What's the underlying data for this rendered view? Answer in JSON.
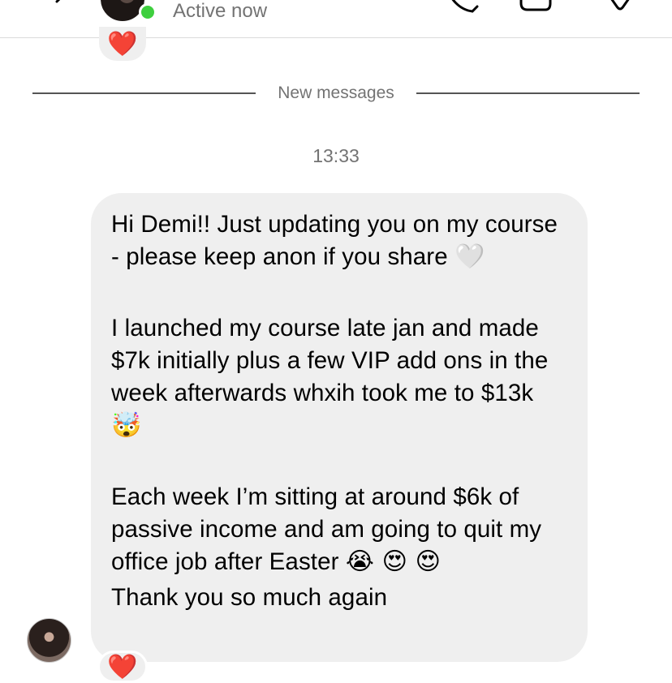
{
  "header": {
    "status": "Active now",
    "icons": [
      "back-icon",
      "avatar",
      "phone-icon",
      "video-icon",
      "tag-icon"
    ],
    "online_color": "#3ecf3e"
  },
  "reactions": {
    "top": "❤️",
    "bottom": "❤️"
  },
  "divider": {
    "label": "New messages"
  },
  "timestamp": "13:33",
  "message": {
    "p1": "Hi Demi!! Just updating you on my course - please keep anon if you share",
    "p1_emoji": "🤍",
    "p2": "I launched my course late jan and made $7k initially plus a few VIP add ons in the week afterwards whxih took me to $13k",
    "p2_emoji": "🤯",
    "p3": "Each week I’m sitting at around $6k of passive income and am going to quit my office job after Easter",
    "p3_emoji": "😭 😍 😍",
    "p4": "Thank you so much again"
  },
  "colors": {
    "bubble": "#efefef",
    "secondary_text": "#737373"
  }
}
